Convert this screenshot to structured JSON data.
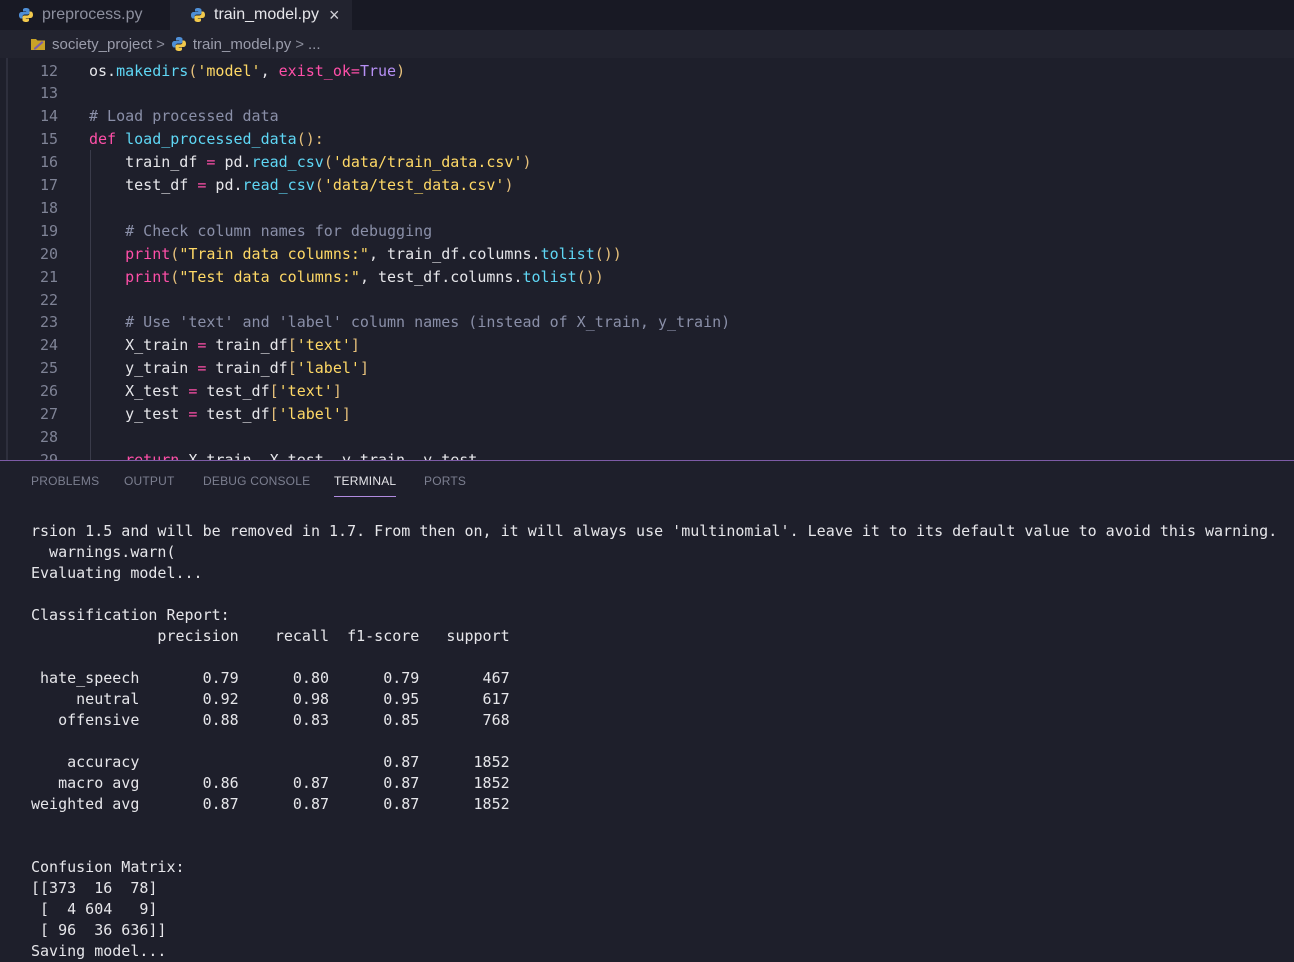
{
  "tabs": [
    {
      "label": "preprocess.py",
      "icon": "python-icon"
    },
    {
      "label": "train_model.py",
      "icon": "python-icon",
      "close": "×"
    }
  ],
  "breadcrumb": {
    "folder": "society_project",
    "sep": ">",
    "file": "train_model.py",
    "ellipsis": "..."
  },
  "code_lines": [
    {
      "n": "12",
      "s": [
        [
          "os.",
          "#e6e6ea"
        ],
        [
          "makedirs",
          "#5fd7f5"
        ],
        [
          "(",
          "#e6c07b"
        ],
        [
          "'model'",
          "#ffd966"
        ],
        [
          ", ",
          "#e6e6ea"
        ],
        [
          "exist_ok",
          "#ff4fa8"
        ],
        [
          "=",
          "#ff4fa8"
        ],
        [
          "True",
          "#b790f5"
        ],
        [
          ")",
          "#e6c07b"
        ]
      ]
    },
    {
      "n": "13",
      "s": []
    },
    {
      "n": "14",
      "s": [
        [
          "# Load processed data",
          "#8a8fa8"
        ]
      ]
    },
    {
      "n": "15",
      "s": [
        [
          "def ",
          "#ff4fa8"
        ],
        [
          "load_processed_data",
          "#5fd7f5"
        ],
        [
          "():",
          "#e6c07b"
        ]
      ]
    },
    {
      "n": "16",
      "s": [
        [
          "    train_df ",
          "#e6e6ea"
        ],
        [
          "=",
          "#ff4fa8"
        ],
        [
          " pd.",
          "#e6e6ea"
        ],
        [
          "read_csv",
          "#5fd7f5"
        ],
        [
          "(",
          "#e6c07b"
        ],
        [
          "'data/train_data.csv'",
          "#ffd966"
        ],
        [
          ")",
          "#e6c07b"
        ]
      ]
    },
    {
      "n": "17",
      "s": [
        [
          "    test_df ",
          "#e6e6ea"
        ],
        [
          "=",
          "#ff4fa8"
        ],
        [
          " pd.",
          "#e6e6ea"
        ],
        [
          "read_csv",
          "#5fd7f5"
        ],
        [
          "(",
          "#e6c07b"
        ],
        [
          "'data/test_data.csv'",
          "#ffd966"
        ],
        [
          ")",
          "#e6c07b"
        ]
      ]
    },
    {
      "n": "18",
      "s": []
    },
    {
      "n": "19",
      "s": [
        [
          "    # Check column names for debugging",
          "#8a8fa8"
        ]
      ]
    },
    {
      "n": "20",
      "s": [
        [
          "    ",
          "#e6e6ea"
        ],
        [
          "print",
          "#ff4fa8"
        ],
        [
          "(",
          "#e6c07b"
        ],
        [
          "\"Train data columns:\"",
          "#ffd966"
        ],
        [
          ", train_df.columns.",
          "#e6e6ea"
        ],
        [
          "tolist",
          "#5fd7f5"
        ],
        [
          "())",
          "#e6c07b"
        ]
      ]
    },
    {
      "n": "21",
      "s": [
        [
          "    ",
          "#e6e6ea"
        ],
        [
          "print",
          "#ff4fa8"
        ],
        [
          "(",
          "#e6c07b"
        ],
        [
          "\"Test data columns:\"",
          "#ffd966"
        ],
        [
          ", test_df.columns.",
          "#e6e6ea"
        ],
        [
          "tolist",
          "#5fd7f5"
        ],
        [
          "())",
          "#e6c07b"
        ]
      ]
    },
    {
      "n": "22",
      "s": []
    },
    {
      "n": "23",
      "s": [
        [
          "    # Use 'text' and 'label' column names (instead of X_train, y_train)",
          "#8a8fa8"
        ]
      ]
    },
    {
      "n": "24",
      "s": [
        [
          "    X_train ",
          "#e6e6ea"
        ],
        [
          "=",
          "#ff4fa8"
        ],
        [
          " train_df",
          "#e6e6ea"
        ],
        [
          "[",
          "#e6c07b"
        ],
        [
          "'text'",
          "#ffd966"
        ],
        [
          "]",
          "#e6c07b"
        ]
      ]
    },
    {
      "n": "25",
      "s": [
        [
          "    y_train ",
          "#e6e6ea"
        ],
        [
          "=",
          "#ff4fa8"
        ],
        [
          " train_df",
          "#e6e6ea"
        ],
        [
          "[",
          "#e6c07b"
        ],
        [
          "'label'",
          "#ffd966"
        ],
        [
          "]",
          "#e6c07b"
        ]
      ]
    },
    {
      "n": "26",
      "s": [
        [
          "    X_test ",
          "#e6e6ea"
        ],
        [
          "=",
          "#ff4fa8"
        ],
        [
          " test_df",
          "#e6e6ea"
        ],
        [
          "[",
          "#e6c07b"
        ],
        [
          "'text'",
          "#ffd966"
        ],
        [
          "]",
          "#e6c07b"
        ]
      ]
    },
    {
      "n": "27",
      "s": [
        [
          "    y_test ",
          "#e6e6ea"
        ],
        [
          "=",
          "#ff4fa8"
        ],
        [
          " test_df",
          "#e6e6ea"
        ],
        [
          "[",
          "#e6c07b"
        ],
        [
          "'label'",
          "#ffd966"
        ],
        [
          "]",
          "#e6c07b"
        ]
      ]
    },
    {
      "n": "28",
      "s": []
    },
    {
      "n": "29",
      "s": [
        [
          "    ",
          "#e6e6ea"
        ],
        [
          "return",
          "#ff4fa8"
        ],
        [
          " X_train, X_test, y_train, y_test",
          "#e6e6ea"
        ]
      ]
    }
  ],
  "panel_tabs": [
    {
      "label": "PROBLEMS",
      "active": false
    },
    {
      "label": "OUTPUT",
      "active": false
    },
    {
      "label": "DEBUG CONSOLE",
      "active": false
    },
    {
      "label": "TERMINAL",
      "active": true
    },
    {
      "label": "PORTS",
      "active": false
    }
  ],
  "terminal_lines": [
    "rsion 1.5 and will be removed in 1.7. From then on, it will always use 'multinomial'. Leave it to its default value to avoid this warning.",
    "  warnings.warn(",
    "Evaluating model...",
    "",
    "Classification Report:",
    "              precision    recall  f1-score   support",
    "",
    " hate_speech       0.79      0.80      0.79       467",
    "     neutral       0.92      0.98      0.95       617",
    "   offensive       0.88      0.83      0.85       768",
    "",
    "    accuracy                           0.87      1852",
    "   macro avg       0.86      0.87      0.87      1852",
    "weighted avg       0.87      0.87      0.87      1852",
    "",
    "",
    "Confusion Matrix:",
    "[[373  16  78]",
    " [  4 604   9]",
    " [ 96  36 636]]",
    "Saving model..."
  ],
  "colors": {
    "accent": "#b18be0",
    "background": "#1e1f2b"
  }
}
